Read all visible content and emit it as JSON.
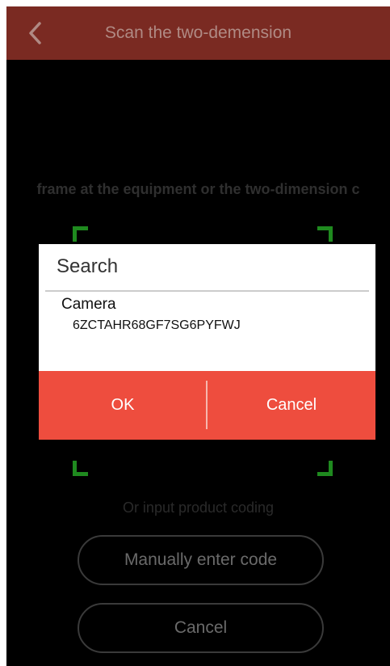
{
  "header": {
    "title": "Scan the two-demension"
  },
  "scan": {
    "instruction": "frame at the equipment or the two-dimension c",
    "or_text": "Or input product coding",
    "manual_button": "Manually enter code",
    "cancel_button": "Cancel"
  },
  "dialog": {
    "title": "Search",
    "device_name": "Camera",
    "device_code": "6ZCTAHR68GF7SG6PYFWJ",
    "ok_label": "OK",
    "cancel_label": "Cancel"
  },
  "colors": {
    "header_bg": "#7a2a22",
    "accent_red": "#ee4d3e",
    "frame_green": "#1f8a1f"
  },
  "icons": {
    "back": "chevron-left-icon"
  }
}
